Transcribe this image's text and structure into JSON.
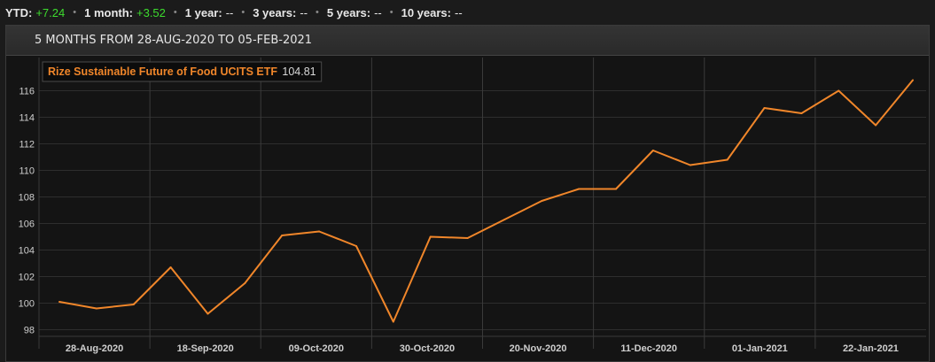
{
  "performance": [
    {
      "label": "YTD:",
      "value": "+7.24",
      "positive": true
    },
    {
      "label": "1 month:",
      "value": "+3.52",
      "positive": true
    },
    {
      "label": "1 year:",
      "value": "--",
      "positive": false
    },
    {
      "label": "3 years:",
      "value": "--",
      "positive": false
    },
    {
      "label": "5 years:",
      "value": "--",
      "positive": false
    },
    {
      "label": "10 years:",
      "value": "--",
      "positive": false
    }
  ],
  "separator": "•",
  "panel": {
    "title": "5 MONTHS FROM 28-AUG-2020 TO 05-FEB-2021"
  },
  "colors": {
    "line": "#f0862a",
    "positive": "#3ddc2e",
    "grid": "#3a3a3a",
    "plot_bg": "#141414"
  },
  "chart_data": {
    "type": "line",
    "series": [
      {
        "name": "Rize Sustainable Future of Food UCITS ETF",
        "last_value_label": "104.81",
        "values": [
          100.1,
          99.6,
          99.9,
          102.7,
          99.2,
          101.5,
          105.1,
          105.4,
          104.3,
          98.6,
          105.0,
          104.9,
          106.3,
          107.7,
          108.6,
          108.6,
          111.5,
          110.4,
          110.8,
          114.7,
          114.3,
          116.0,
          113.4,
          116.8
        ]
      }
    ],
    "x_tick_labels": [
      "28-Aug-2020",
      "18-Sep-2020",
      "09-Oct-2020",
      "30-Oct-2020",
      "20-Nov-2020",
      "11-Dec-2020",
      "01-Jan-2021",
      "22-Jan-2021"
    ],
    "y_ticks": [
      98,
      100,
      102,
      104,
      106,
      108,
      110,
      112,
      114,
      116
    ],
    "ylim": [
      97.5,
      118.5
    ],
    "grid": true,
    "legend_position": "top-left"
  }
}
